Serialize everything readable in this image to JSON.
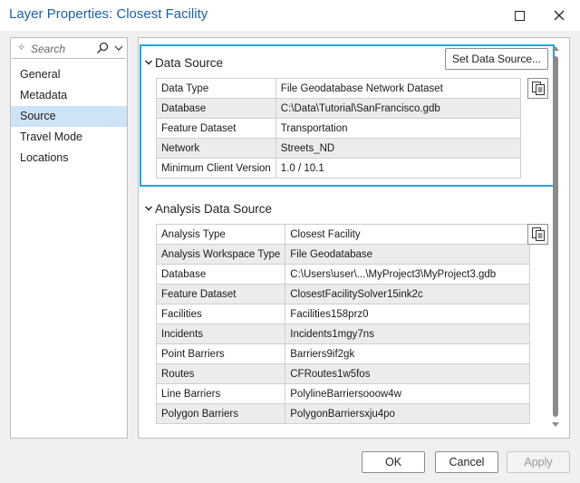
{
  "window": {
    "title": "Layer Properties: Closest Facility"
  },
  "search": {
    "placeholder": "Search"
  },
  "nav": {
    "items": [
      "General",
      "Metadata",
      "Source",
      "Travel Mode",
      "Locations"
    ],
    "selected": "Source"
  },
  "data_source": {
    "header": "Data Source",
    "set_button": "Set Data Source...",
    "rows": [
      {
        "key": "Data Type",
        "value": "File Geodatabase Network Dataset"
      },
      {
        "key": "Database",
        "value": "C:\\Data\\Tutorial\\SanFrancisco.gdb"
      },
      {
        "key": "Feature Dataset",
        "value": "Transportation"
      },
      {
        "key": "Network",
        "value": "Streets_ND"
      },
      {
        "key": "Minimum Client Version",
        "value": "1.0 / 10.1"
      }
    ]
  },
  "analysis_source": {
    "header": "Analysis Data Source",
    "rows": [
      {
        "key": "Analysis Type",
        "value": "Closest Facility"
      },
      {
        "key": "Analysis Workspace Type",
        "value": "File Geodatabase"
      },
      {
        "key": "Database",
        "value": "C:\\Users\\user\\...\\MyProject3\\MyProject3.gdb"
      },
      {
        "key": "Feature Dataset",
        "value": "ClosestFacilitySolver15ink2c"
      },
      {
        "key": "Facilities",
        "value": "Facilities158prz0"
      },
      {
        "key": "Incidents",
        "value": "Incidents1mgy7ns"
      },
      {
        "key": "Point Barriers",
        "value": "Barriers9if2gk"
      },
      {
        "key": "Routes",
        "value": "CFRoutes1w5fos"
      },
      {
        "key": "Line Barriers",
        "value": "PolylineBarriersooow4w"
      },
      {
        "key": "Polygon Barriers",
        "value": "PolygonBarriersxju4po"
      }
    ]
  },
  "buttons": {
    "ok": "OK",
    "cancel": "Cancel",
    "apply": "Apply"
  },
  "colors": {
    "accent": "#1ea7d9",
    "title": "#1f5fa8",
    "selected_bg": "#cde3f6"
  }
}
